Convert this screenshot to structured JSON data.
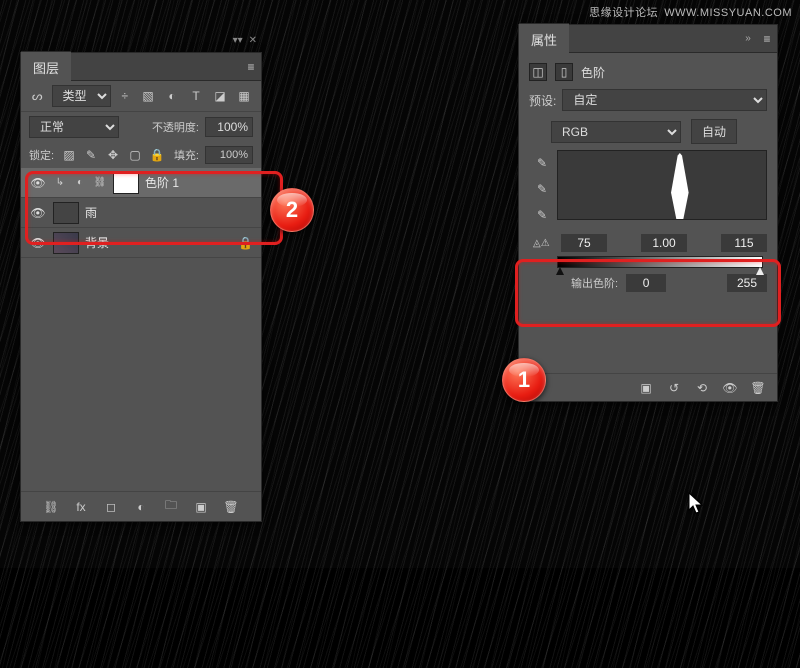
{
  "watermark_cn": "思缘设计论坛",
  "watermark_url": "WWW.MISSYUAN.COM",
  "layers_panel": {
    "title": "图层",
    "filter_label": "类型",
    "blend_mode": "正常",
    "opacity_label": "不透明度:",
    "opacity_value": "100%",
    "lock_label": "锁定:",
    "fill_label": "填充:",
    "fill_value": "100%",
    "layers": [
      {
        "name": "色阶 1",
        "selected": true,
        "type": "adjustment"
      },
      {
        "name": "雨",
        "selected": false,
        "type": "pixel"
      },
      {
        "name": "背景",
        "selected": false,
        "type": "pixel",
        "locked": true
      }
    ]
  },
  "props_panel": {
    "title": "属性",
    "adjustment_name": "色阶",
    "preset_label": "预设:",
    "preset_value": "自定",
    "channel": "RGB",
    "auto_label": "自动",
    "input_black": "75",
    "input_gamma": "1.00",
    "input_white": "115",
    "output_label": "输出色阶:",
    "output_black": "0",
    "output_white": "255"
  },
  "badge1": "1",
  "badge2": "2"
}
